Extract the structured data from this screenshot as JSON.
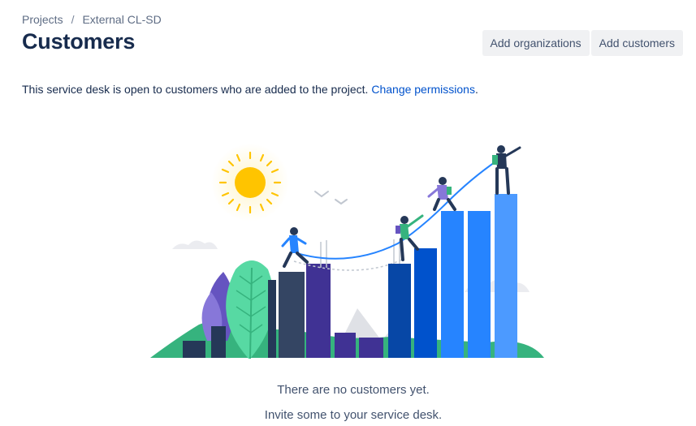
{
  "breadcrumb": {
    "items": [
      "Projects",
      "External CL-SD"
    ],
    "separator": "/"
  },
  "page_title": "Customers",
  "actions": {
    "add_organizations": "Add organizations",
    "add_customers": "Add customers"
  },
  "intro": {
    "text": "This service desk is open to customers who are added to the project.",
    "link": "Change permissions",
    "suffix": "."
  },
  "empty_state": {
    "title": "There are no customers yet.",
    "subtitle": "Invite some to your service desk."
  },
  "colors": {
    "link": "#0052cc",
    "title": "#172b4d",
    "button_bg": "#f0f1f3",
    "sun": "#ffc400",
    "bar_blue": "#2684ff",
    "bar_dark": "#253858",
    "foliage": "#36b37e",
    "foliage_purple": "#6554c0"
  }
}
